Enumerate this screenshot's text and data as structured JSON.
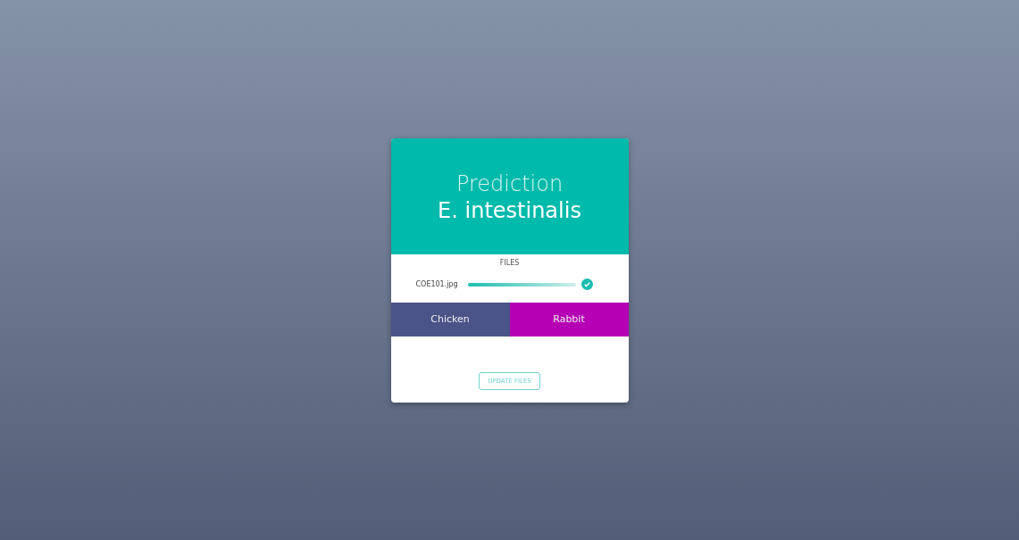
{
  "prediction": {
    "label": "Prediction",
    "value": "E. intestinalis"
  },
  "files": {
    "heading": "FILES",
    "items": [
      {
        "name": "COE101.jpg",
        "level": 1,
        "done": true
      }
    ]
  },
  "options": [
    {
      "label": "Chicken",
      "color": "#4a5488"
    },
    {
      "label": "Rabbit",
      "color": "#b500b3"
    }
  ],
  "update_button": "UPDATE FILES"
}
